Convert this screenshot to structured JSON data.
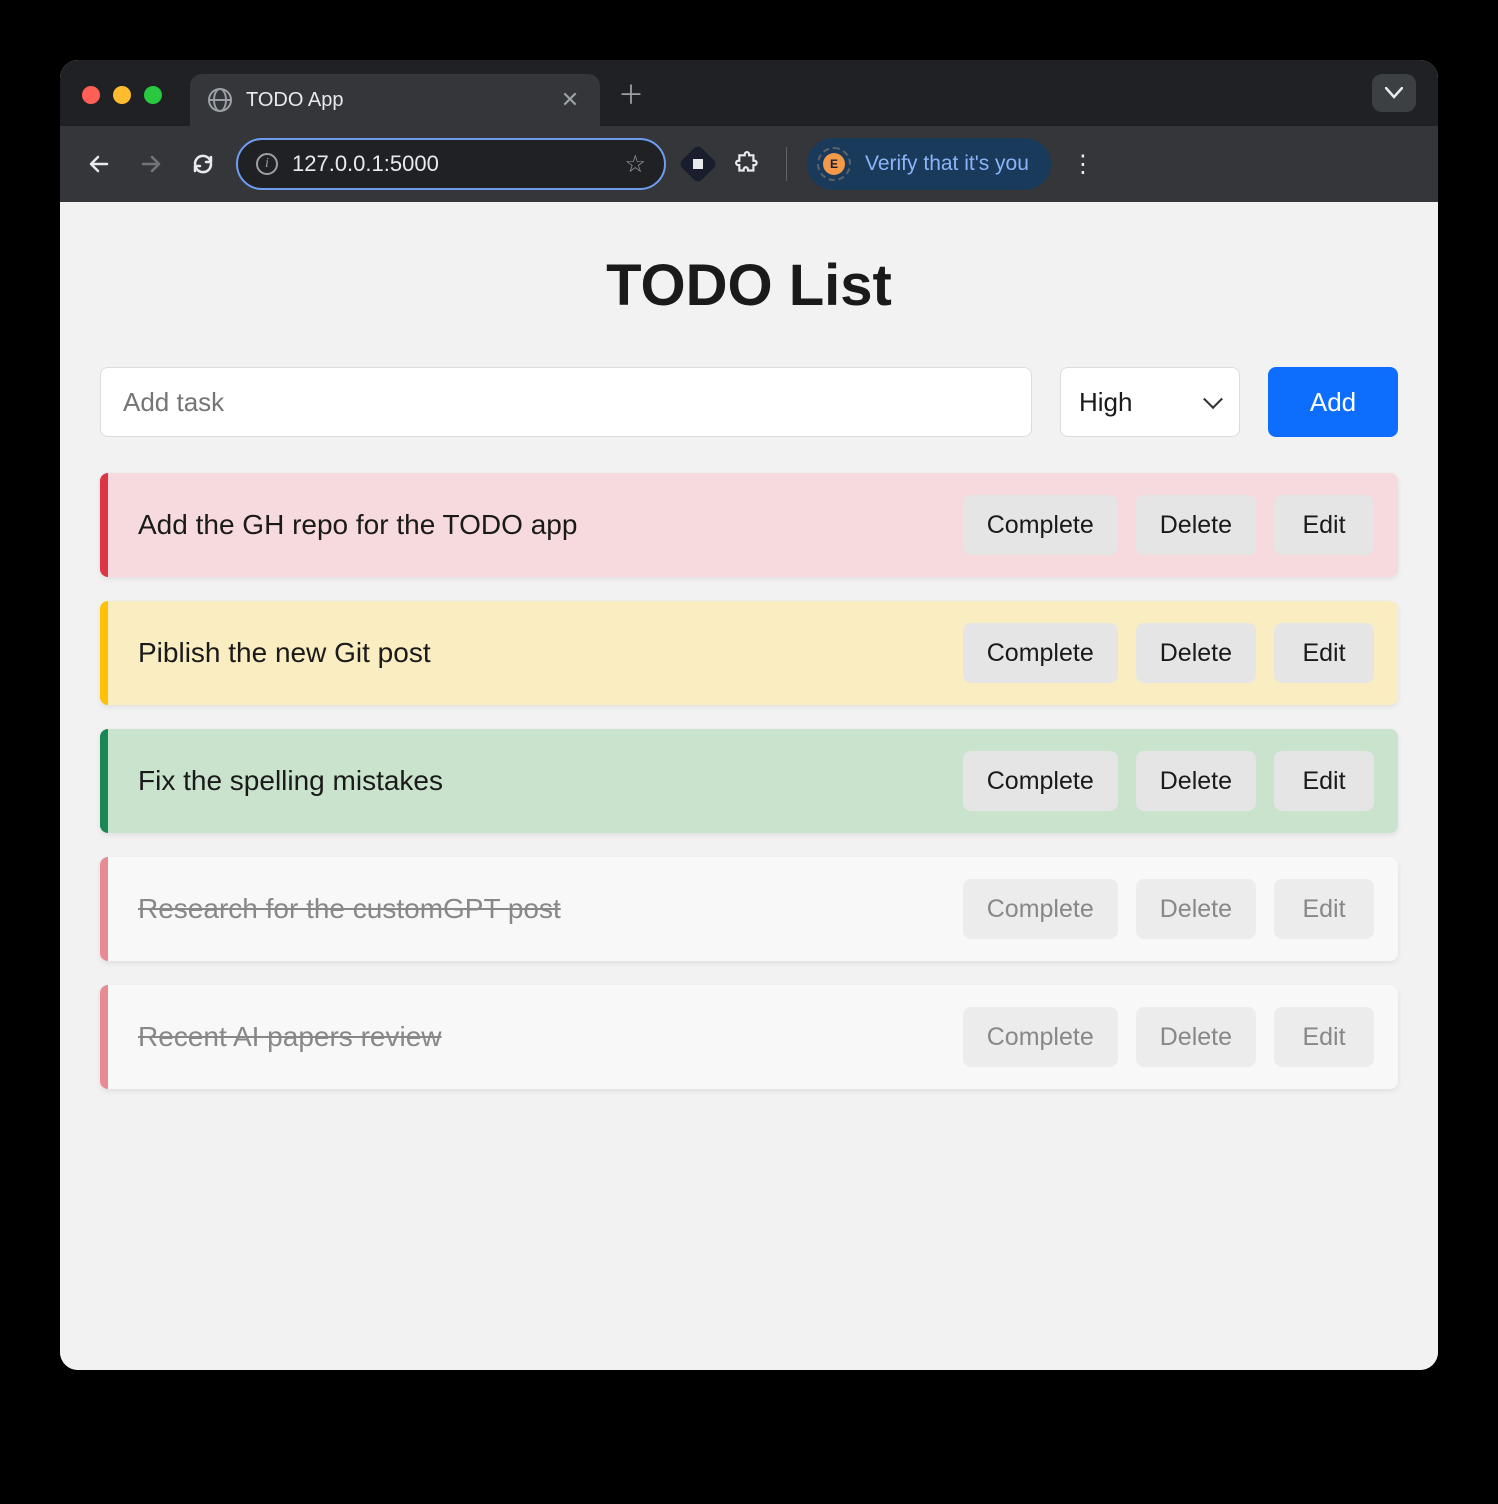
{
  "browser": {
    "tab_title": "TODO App",
    "url": "127.0.0.1:5000",
    "verify_label": "Verify that it's you",
    "avatar_initial": "E"
  },
  "app": {
    "title": "TODO List",
    "input_placeholder": "Add task",
    "priority_selected": "High",
    "add_button_label": "Add",
    "buttons": {
      "complete": "Complete",
      "delete": "Delete",
      "edit": "Edit"
    },
    "tasks": [
      {
        "text": "Add the GH repo for the TODO app",
        "priority": "high",
        "done": false
      },
      {
        "text": "Piblish the new Git post",
        "priority": "med",
        "done": false
      },
      {
        "text": "Fix the spelling mistakes",
        "priority": "low",
        "done": false
      },
      {
        "text": "Research for the customGPT post",
        "priority": "high",
        "done": true
      },
      {
        "text": "Recent AI papers review",
        "priority": "high",
        "done": true
      }
    ]
  }
}
